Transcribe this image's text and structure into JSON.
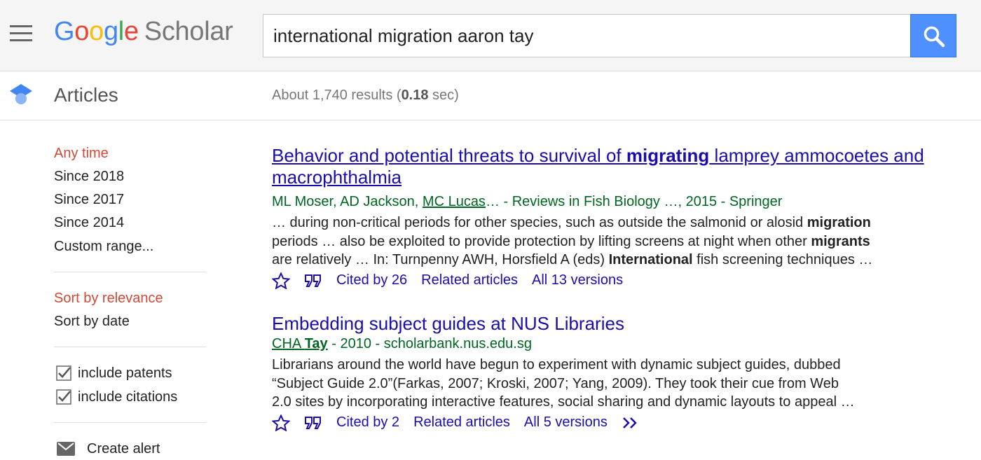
{
  "header": {
    "logo": {
      "g1": "G",
      "o1": "o",
      "o2": "o",
      "g2": "g",
      "l": "l",
      "e": "e",
      "scholar": "Scholar"
    },
    "search": {
      "query": "international migration aaron tay"
    },
    "colors": {
      "search_button": "#4d90fe",
      "link": "#1a0dab",
      "meta_green": "#006621",
      "active_red": "#d14836"
    }
  },
  "subheader": {
    "section": "Articles",
    "stats_prefix": "About 1,740 results (",
    "stats_time": "0.18",
    "stats_suffix": " sec)"
  },
  "sidebar": {
    "time_filters": [
      "Any time",
      "Since 2018",
      "Since 2017",
      "Since 2014",
      "Custom range..."
    ],
    "sort_options": [
      "Sort by relevance",
      "Sort by date"
    ],
    "include_patents": "include patents",
    "include_citations": "include citations",
    "create_alert": "Create alert"
  },
  "results": [
    {
      "title_line1_pre": "Behavior and potential threats to survival of ",
      "title_line1_bold": "migrating",
      "title_line1_post": " lamprey ammocoetes and",
      "title_line2": "macrophthalmia",
      "meta_authors": "ML Moser, AD Jackson, ",
      "meta_author_link": "MC Lucas",
      "meta_rest": "… - Reviews in Fish Biology …, 2015 - Springer",
      "snippet": {
        "l1_pre": "… during non-critical periods for other species, such as outside the salmonid or alosid ",
        "l1_bold": "migration",
        "l2_pre": "periods … also be exploited to provide protection by lifting screens at night when other ",
        "l2_bold": "migrants",
        "l3_pre": "are relatively … In: Turnpenny AWH, Horsfield A (eds) ",
        "l3_bold": "International",
        "l3_post": " fish screening techniques …"
      },
      "cited_by": "Cited by 26",
      "related": "Related articles",
      "versions": "All 13 versions"
    },
    {
      "title": "Embedding subject guides at NUS Libraries",
      "meta_author_pre": "CHA ",
      "meta_author_bold": "Tay",
      "meta_rest": " - 2010 - scholarbank.nus.edu.sg",
      "snippet": {
        "l1": "Librarians around the world have begun to experiment with dynamic subject guides, dubbed",
        "l2": "“Subject Guide 2.0”(Farkas, 2007; Kroski, 2007; Yang, 2009). They took their cue from Web",
        "l3": "2.0 sites by incorporating interactive features, social sharing and dynamic layouts to appeal …"
      },
      "cited_by": "Cited by 2",
      "related": "Related articles",
      "versions": "All 5 versions"
    }
  ]
}
